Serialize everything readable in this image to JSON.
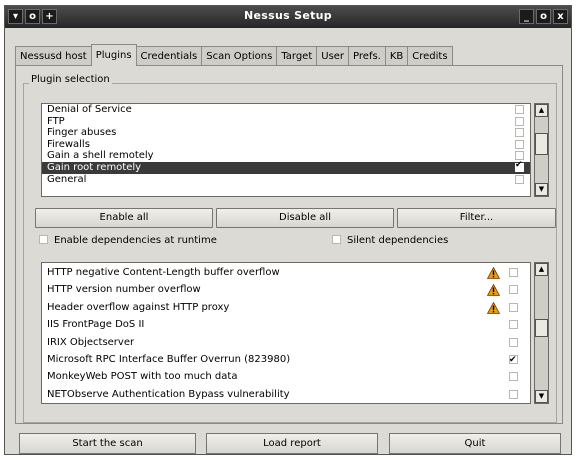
{
  "window": {
    "title": "Nessus Setup",
    "titlebar_left_icons": [
      "▾",
      "o",
      "+"
    ],
    "titlebar_right_icons": [
      "_",
      "o",
      "x"
    ]
  },
  "tabs": [
    {
      "label": "Nessusd host",
      "active": false
    },
    {
      "label": "Plugins",
      "active": true
    },
    {
      "label": "Credentials",
      "active": false
    },
    {
      "label": "Scan Options",
      "active": false
    },
    {
      "label": "Target",
      "active": false
    },
    {
      "label": "User",
      "active": false
    },
    {
      "label": "Prefs.",
      "active": false
    },
    {
      "label": "KB",
      "active": false
    },
    {
      "label": "Credits",
      "active": false
    }
  ],
  "plugin_selection": {
    "title": "Plugin selection",
    "families": [
      {
        "label": "Denial of Service",
        "checked": false,
        "selected": false
      },
      {
        "label": "FTP",
        "checked": false,
        "selected": false
      },
      {
        "label": "Finger abuses",
        "checked": false,
        "selected": false
      },
      {
        "label": "Firewalls",
        "checked": false,
        "selected": false
      },
      {
        "label": "Gain a shell remotely",
        "checked": false,
        "selected": false
      },
      {
        "label": "Gain root remotely",
        "checked": true,
        "selected": true
      },
      {
        "label": "General",
        "checked": false,
        "selected": false
      }
    ],
    "buttons": {
      "enable_all": "Enable all",
      "disable_all": "Disable all",
      "filter": "Filter..."
    },
    "options": {
      "enable_dependencies": {
        "label": "Enable dependencies at runtime",
        "checked": false
      },
      "silent_dependencies": {
        "label": "Silent dependencies",
        "checked": false
      }
    },
    "plugins": [
      {
        "label": "HTTP negative Content-Length buffer overflow",
        "warning": true,
        "checked": false
      },
      {
        "label": "HTTP version number overflow",
        "warning": true,
        "checked": false
      },
      {
        "label": "Header overflow against HTTP proxy",
        "warning": true,
        "checked": false
      },
      {
        "label": "IIS FrontPage DoS II",
        "warning": false,
        "checked": false
      },
      {
        "label": "IRIX Objectserver",
        "warning": false,
        "checked": false
      },
      {
        "label": "Microsoft RPC Interface Buffer Overrun (823980)",
        "warning": false,
        "checked": true
      },
      {
        "label": "MonkeyWeb POST with too much data",
        "warning": false,
        "checked": false
      },
      {
        "label": "NETObserve Authentication Bypass vulnerability",
        "warning": false,
        "checked": false
      }
    ]
  },
  "footer": {
    "start_scan": "Start the scan",
    "load_report": "Load report",
    "quit": "Quit"
  },
  "colors": {
    "window_bg": "#dcdad5",
    "titlebar": "#262626",
    "selection": "#3a3a3a",
    "warning": "#e89a1a"
  },
  "icons": {
    "warning": "warning-triangle-icon",
    "scroll_up": "up-arrow-icon",
    "scroll_down": "down-arrow-icon"
  }
}
